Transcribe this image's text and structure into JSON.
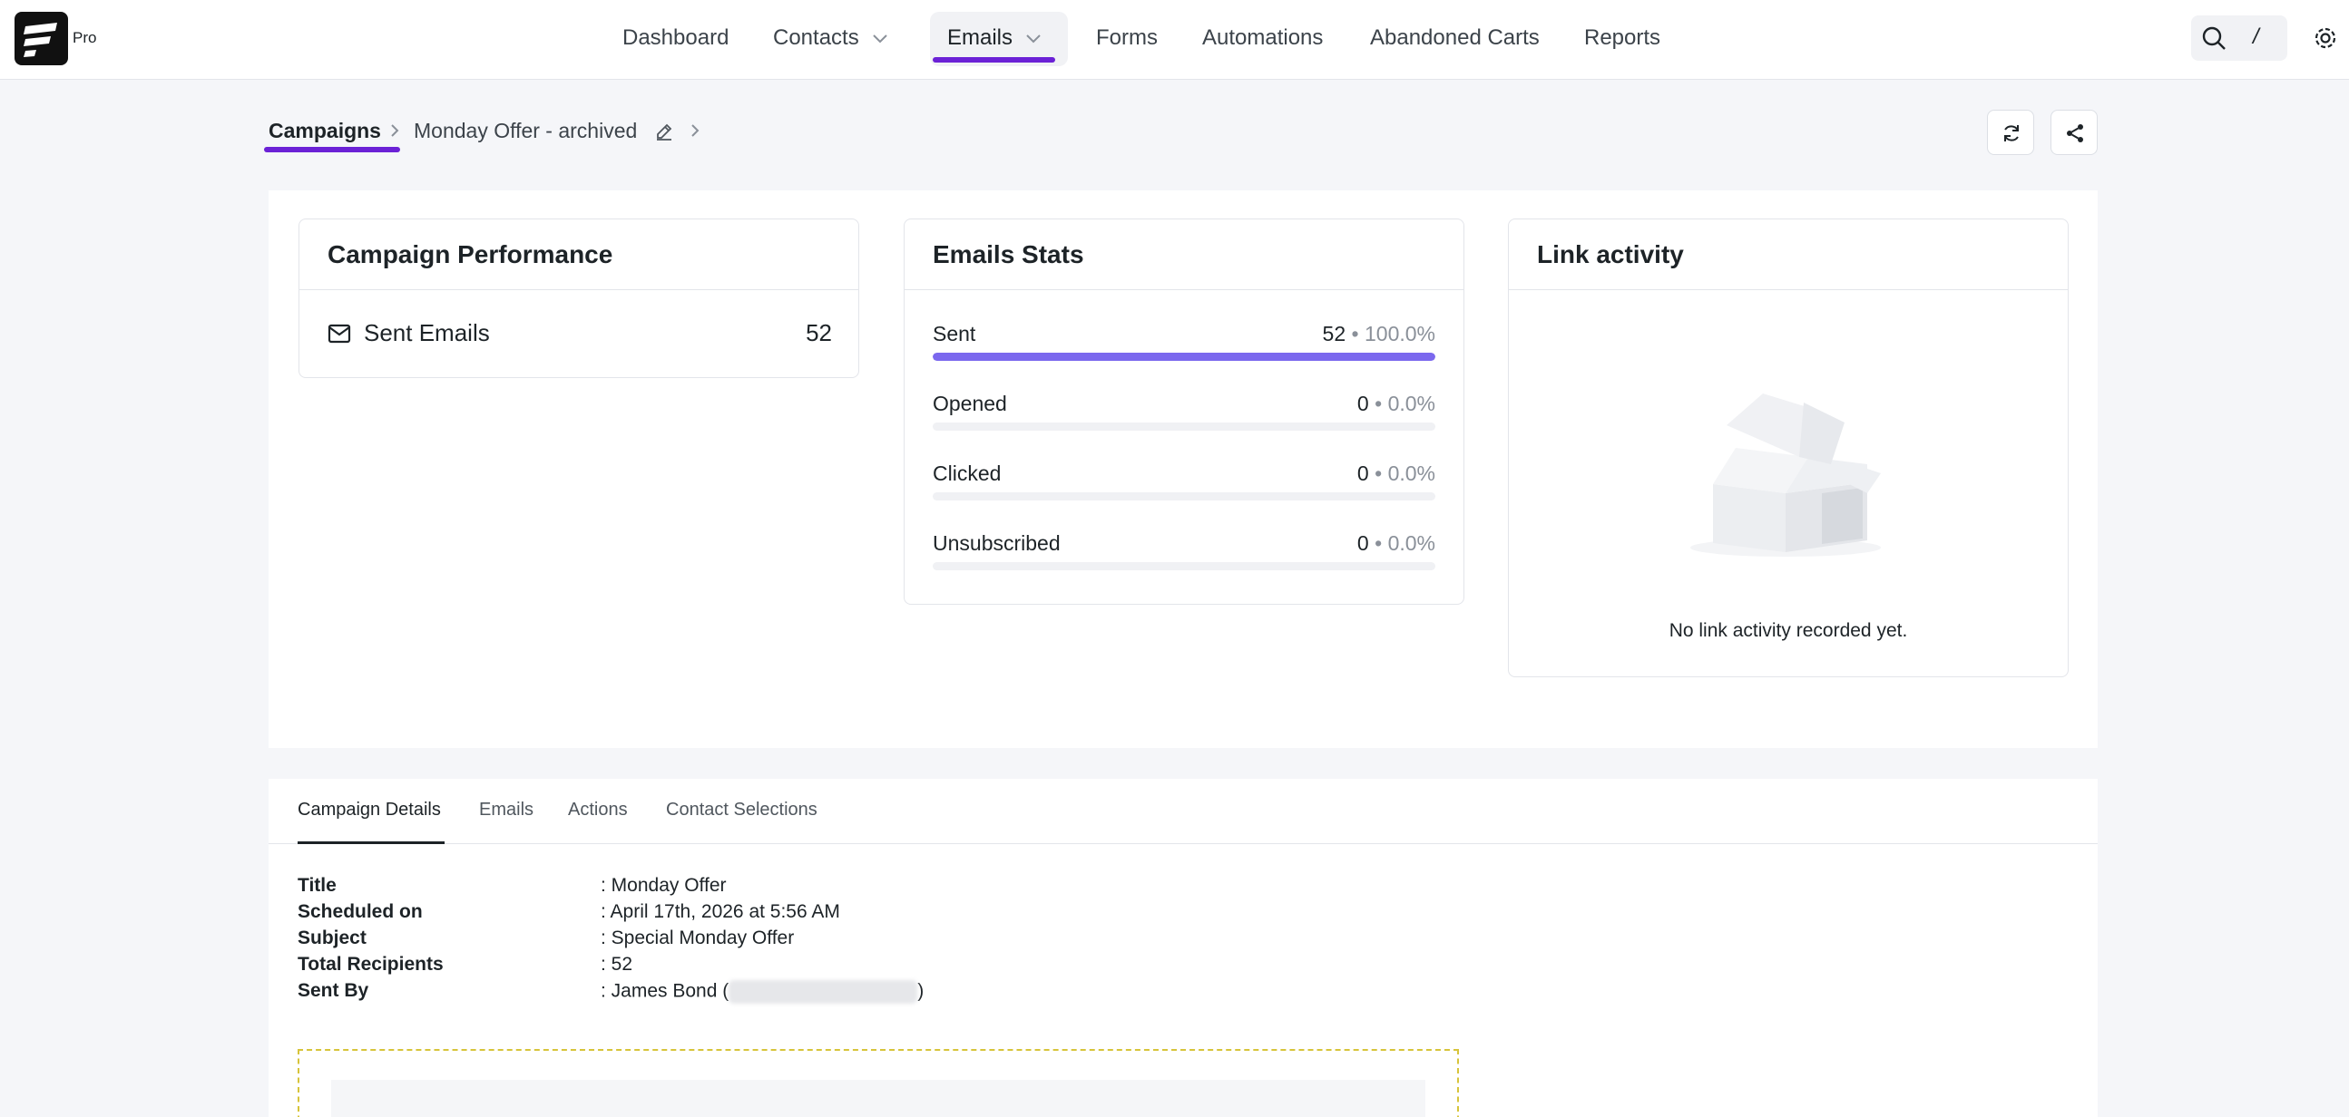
{
  "app": {
    "badge": "Pro"
  },
  "nav": {
    "dashboard": "Dashboard",
    "contacts": "Contacts",
    "emails": "Emails",
    "forms": "Forms",
    "automations": "Automations",
    "abandoned_carts": "Abandoned Carts",
    "reports": "Reports",
    "search_shortcut": "/"
  },
  "breadcrumb": {
    "root": "Campaigns",
    "current": "Monday Offer - archived"
  },
  "performance": {
    "title": "Campaign Performance",
    "sent_label": "Sent Emails",
    "sent_value": "52"
  },
  "email_stats": {
    "title": "Emails Stats",
    "rows": [
      {
        "name": "Sent",
        "count": "52",
        "pct": "100.0%",
        "fraction": 1.0
      },
      {
        "name": "Opened",
        "count": "0",
        "pct": "0.0%",
        "fraction": 0
      },
      {
        "name": "Clicked",
        "count": "0",
        "pct": "0.0%",
        "fraction": 0
      },
      {
        "name": "Unsubscribed",
        "count": "0",
        "pct": "0.0%",
        "fraction": 0
      }
    ],
    "separator": "•"
  },
  "link_activity": {
    "title": "Link activity",
    "empty": "No link activity recorded yet."
  },
  "tabs": {
    "details": "Campaign Details",
    "emails": "Emails",
    "actions": "Actions",
    "selections": "Contact Selections"
  },
  "details": {
    "title_k": "Title",
    "title_v": ": Monday Offer",
    "scheduled_k": "Scheduled on",
    "scheduled_v": ": April 17th, 2026 at 5:56 AM",
    "subject_k": "Subject",
    "subject_v": ": Special Monday Offer",
    "recipients_k": "Total Recipients",
    "recipients_v": ": 52",
    "sentby_k": "Sent By",
    "sentby_v": ": James Bond (",
    "sentby_close": ")"
  },
  "colors": {
    "accent": "#6b21d6",
    "bar": "#7b68ee"
  }
}
